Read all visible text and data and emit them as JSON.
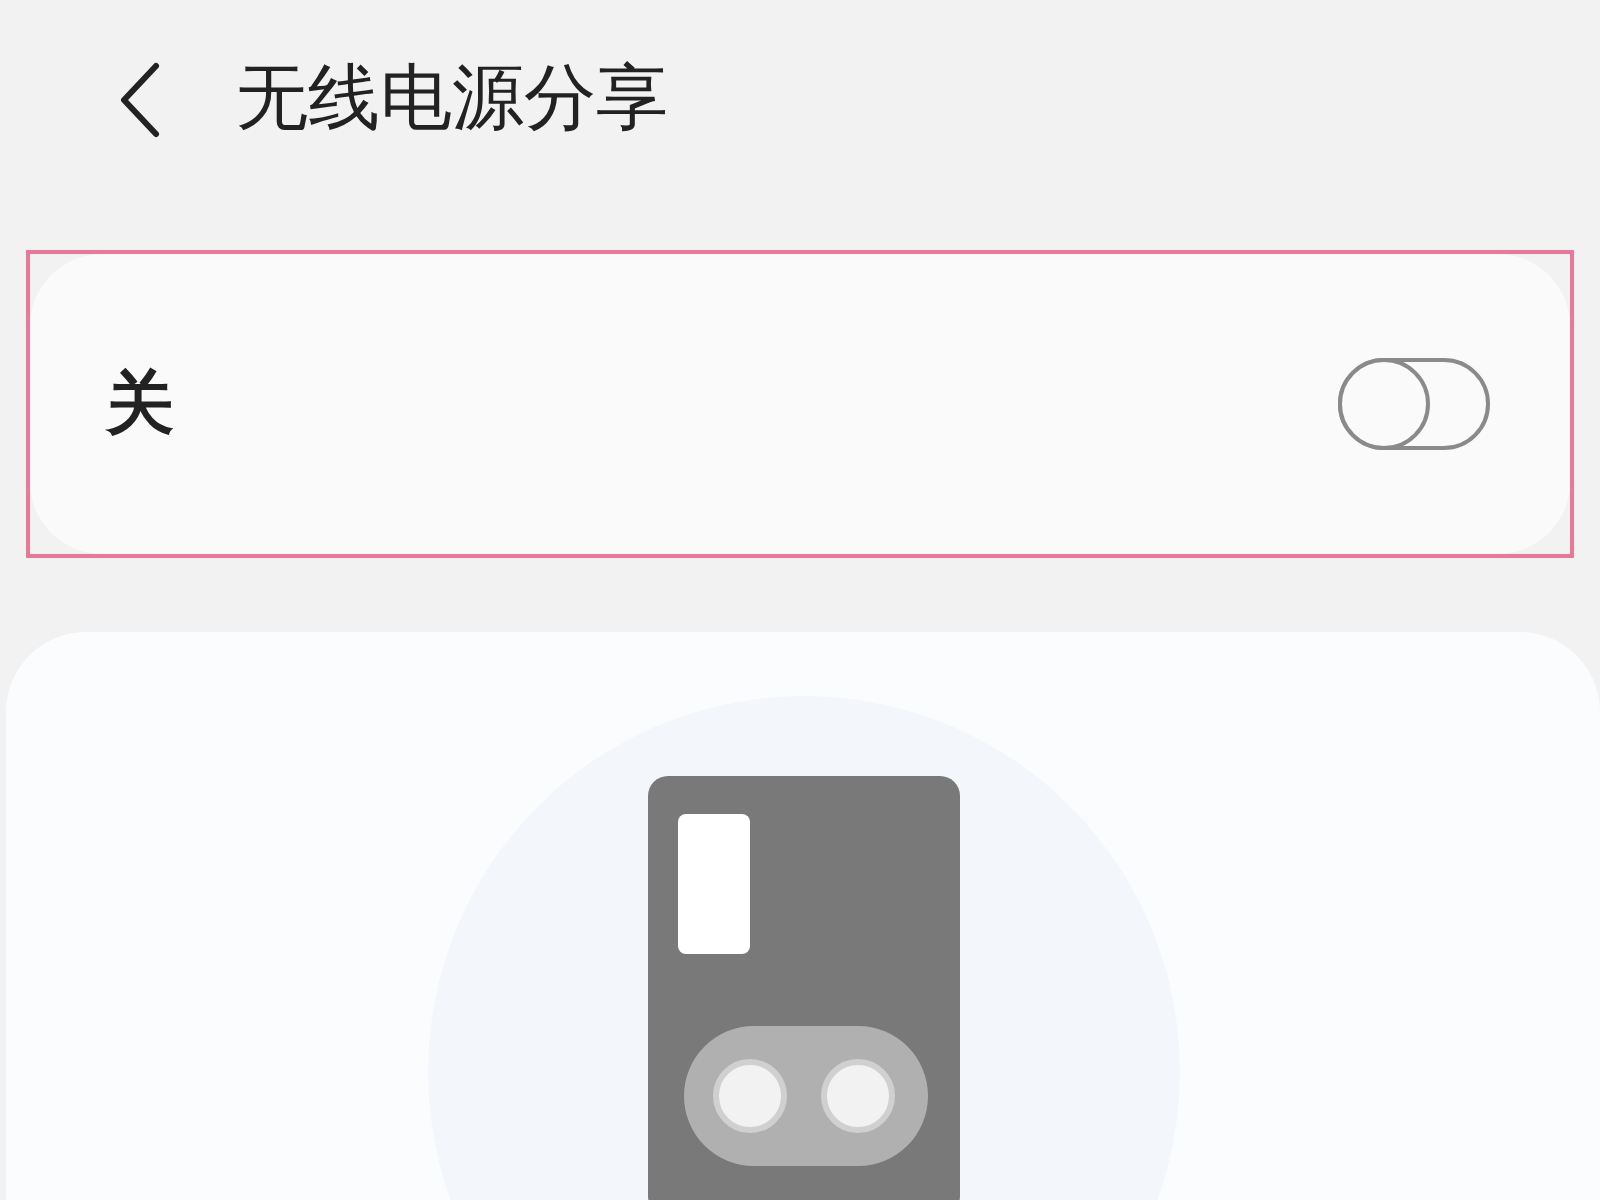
{
  "header": {
    "title": "无线电源分享"
  },
  "power_share": {
    "label": "关",
    "on": false
  }
}
